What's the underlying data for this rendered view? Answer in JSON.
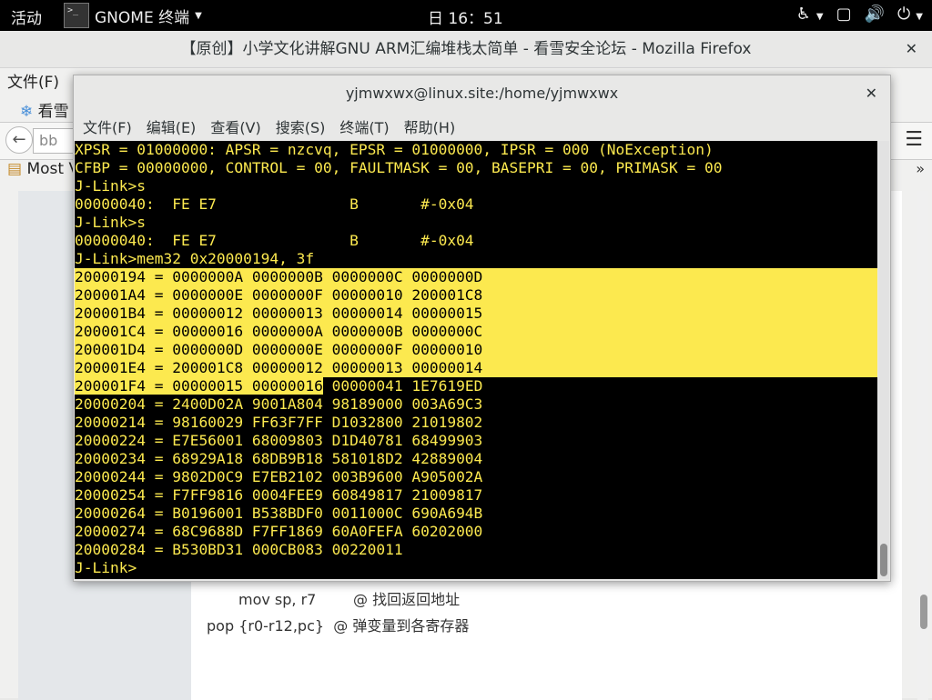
{
  "topbar": {
    "activities": "活动",
    "app_name": "GNOME 终端",
    "clock": "日 16：51"
  },
  "firefox": {
    "title": "【原创】小学文化讲解GNU ARM汇编堆栈太简单 - 看雪安全论坛 - Mozilla Firefox",
    "menu_first": "文件(F)",
    "tab_label": "看雪",
    "url_partial": "bb",
    "bookmark_label": "Most V",
    "code_lines": [
      "mov sp, r7        @ 找回返回地址",
      "pop {r0-r12,pc}  @ 弹变量到各寄存器"
    ]
  },
  "terminal": {
    "title": "yjmwxwx@linux.site:/home/yjmwxwx",
    "menu": [
      "文件(F)",
      "编辑(E)",
      "查看(V)",
      "搜索(S)",
      "终端(T)",
      "帮助(H)"
    ],
    "lines": [
      "XPSR = 01000000: APSR = nzcvq, EPSR = 01000000, IPSR = 000 (NoException)",
      "CFBP = 00000000, CONTROL = 00, FAULTMASK = 00, BASEPRI = 00, PRIMASK = 00",
      "J-Link>s",
      "00000040:  FE E7               B       #-0x04",
      "J-Link>s",
      "00000040:  FE E7               B       #-0x04",
      "J-Link>mem32 0x20000194, 3f",
      "20000194 = 0000000A 0000000B 0000000C 0000000D",
      "200001A4 = 0000000E 0000000F 00000010 200001C8",
      "200001B4 = 00000012 00000013 00000014 00000015",
      "200001C4 = 00000016 0000000A 0000000B 0000000C",
      "200001D4 = 0000000D 0000000E 0000000F 00000010",
      "200001E4 = 200001C8 00000012 00000013 00000014",
      "200001F4 = 00000015 00000016",
      " 00000041 1E7619ED",
      "20000204 = 2400D02A 9001A804 98189000 003A69C3",
      "20000214 = 98160029 FF63F7FF D1032800 21019802",
      "20000224 = E7E56001 68009803 D1D40781 68499903",
      "20000234 = 68929A18 68DB9B18 581018D2 42889004",
      "20000244 = 9802D0C9 E7EB2102 003B9600 A905002A",
      "20000254 = F7FF9816 0004FEE9 60849817 21009817",
      "20000264 = B0196001 B538BDF0 0011000C 690A694B",
      "20000274 = 68C9688D F7FF1869 60A0FEFA 60202000",
      "20000284 = B530BD31 000CB083 00220011",
      "J-Link>"
    ]
  }
}
